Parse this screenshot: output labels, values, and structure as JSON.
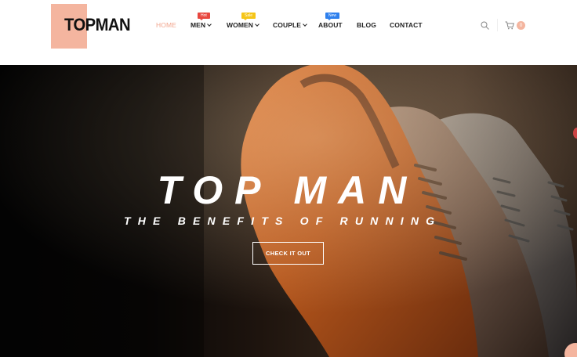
{
  "brand": {
    "name": "TOPMAN"
  },
  "nav": {
    "home": "HOME",
    "men": "MEN",
    "women": "WOMEN",
    "couple": "COUPLE",
    "about": "ABOUT",
    "blog": "BLOG",
    "contact": "CONTACT",
    "badges": {
      "men": "Hot",
      "women": "Sale",
      "about": "New"
    }
  },
  "cart": {
    "count": "0"
  },
  "hero": {
    "title": "TOP MAN",
    "subtitle": "THE BENEFITS OF RUNNING",
    "button": "CHECK IT OUT"
  },
  "colors": {
    "accent": "#f4b59f",
    "hot": "#e8473f",
    "sale": "#f5c518",
    "new": "#2f80ed"
  }
}
